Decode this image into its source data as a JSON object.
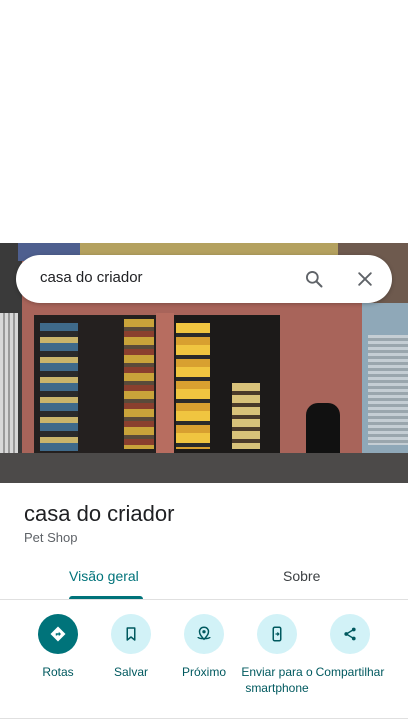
{
  "search": {
    "query": "casa do criador"
  },
  "place": {
    "name": "casa do criador",
    "category": "Pet Shop"
  },
  "tabs": [
    {
      "label": "Visão geral",
      "active": true
    },
    {
      "label": "Sobre",
      "active": false
    }
  ],
  "actions": [
    {
      "label": "Rotas",
      "icon": "directions-icon"
    },
    {
      "label": "Salvar",
      "icon": "bookmark-icon"
    },
    {
      "label": "Próximo",
      "icon": "nearby-icon"
    },
    {
      "label": "Enviar para o smartphone",
      "icon": "send-to-phone-icon"
    },
    {
      "label": "Compartilhar",
      "icon": "share-icon"
    }
  ],
  "colors": {
    "accent": "#00737a",
    "action_bg": "#d2f2f7"
  }
}
